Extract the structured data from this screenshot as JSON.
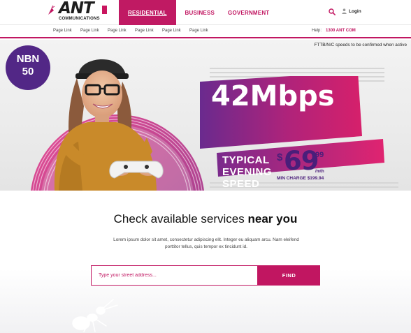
{
  "brand": {
    "logo_text": "ANT",
    "logo_sub": "COMMUNICATIONS"
  },
  "nav": {
    "items": [
      {
        "label": "RESIDENTIAL"
      },
      {
        "label": "BUSINESS"
      },
      {
        "label": "GOVERNMENT"
      }
    ],
    "login_label": "Login"
  },
  "subnav": {
    "links": [
      "Page Link",
      "Page Link",
      "Page Link",
      "Page Link",
      "Page Link",
      "Page Link"
    ],
    "help_label": "Help:",
    "help_number": "1300 ANT COM"
  },
  "hero": {
    "note": "FTTB/N/C speeds to be confirmed when active",
    "badge_line1": "NBN",
    "badge_line2": "50",
    "speed": "42Mbps",
    "speed_caption": "TYPICAL EVENING SPEED",
    "price_symbol": "$",
    "price_main": "69",
    "price_cents": "99",
    "price_period": "/mth",
    "min_charge": "MIN CHARGE $199.94"
  },
  "check": {
    "title_lead": "Check available services",
    "title_bold": "near you",
    "description": "Lorem ipsum dolor sit amet, consectetur adipiscing elit. Integer eu aliquam arcu. Nam eleifend porttitor tellus, quis tempor ex tincidunt id.",
    "address_placeholder": "Type your street address...",
    "find_label": "FIND"
  },
  "colors": {
    "brand_magenta": "#c11661",
    "brand_purple": "#522786",
    "text_dark": "#222222"
  },
  "icons": {
    "search": "search-icon",
    "user": "user-icon",
    "ant": "ant-icon"
  }
}
